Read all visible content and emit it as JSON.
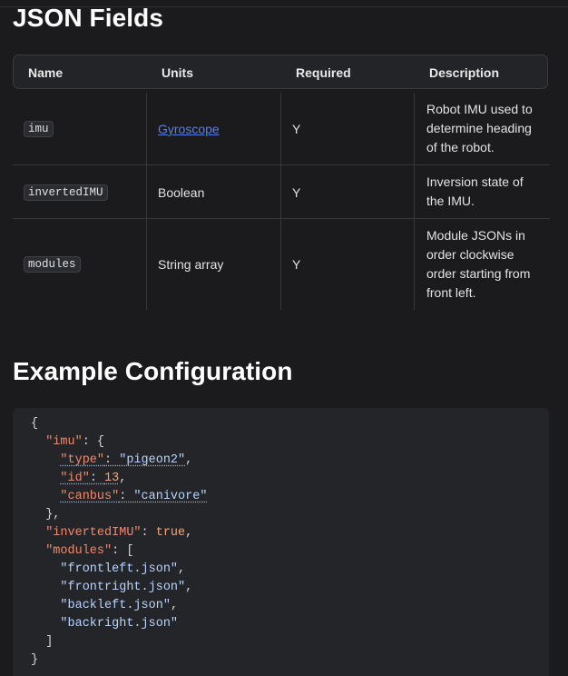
{
  "headings": {
    "json_fields": "JSON Fields",
    "example_config": "Example Configuration"
  },
  "table": {
    "columns": [
      "Name",
      "Units",
      "Required",
      "Description"
    ],
    "rows": [
      {
        "name": "imu",
        "units": "Gyroscope",
        "units_is_link": true,
        "required": "Y",
        "description_lines": [
          "Robot IMU used to",
          "determine heading",
          "of the robot."
        ]
      },
      {
        "name": "invertedIMU",
        "units": "Boolean",
        "units_is_link": false,
        "required": "Y",
        "description_lines": [
          "Inversion state of",
          "the IMU."
        ]
      },
      {
        "name": "modules",
        "units": "String array",
        "units_is_link": false,
        "required": "Y",
        "description_lines": [
          "Module JSONs in",
          "order clockwise",
          "order starting from",
          "front left."
        ]
      }
    ]
  },
  "code": {
    "imu_key": "\"imu\"",
    "type_key": "\"type\"",
    "type_val": "\"pigeon2\"",
    "id_key": "\"id\"",
    "id_val": "13",
    "canbus_key": "\"canbus\"",
    "canbus_val": "\"canivore\"",
    "inverted_key": "\"invertedIMU\"",
    "inverted_val": "true",
    "modules_key": "\"modules\"",
    "mod1": "\"frontleft.json\"",
    "mod2": "\"frontright.json\"",
    "mod3": "\"backleft.json\"",
    "mod4": "\"backright.json\""
  },
  "colors": {
    "background": "#1b1b1d",
    "link": "#5b7fe1",
    "code_key": "#ee8a6b",
    "code_string": "#b7d4ff"
  }
}
